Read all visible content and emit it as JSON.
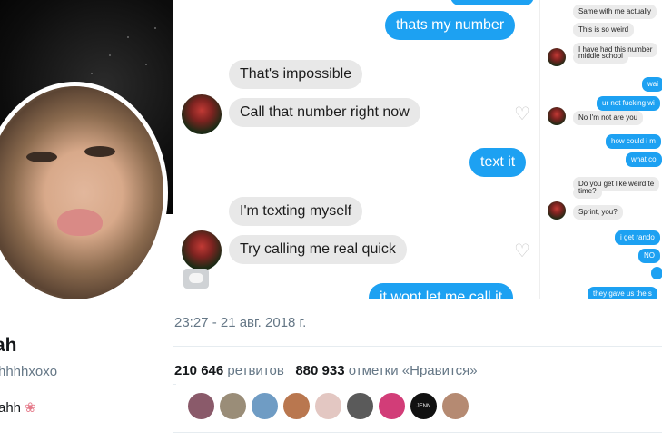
{
  "profile": {
    "name": "ah",
    "handle": "hhhhxoxo",
    "bio": "ahh",
    "bio_icon": "flower-icon"
  },
  "chat": {
    "main": [
      {
        "side": "sent",
        "text": "thats my number"
      },
      {
        "side": "recv",
        "text": "That's impossible"
      },
      {
        "side": "recv",
        "text": "Call that number right now"
      },
      {
        "side": "sent",
        "text": "text it"
      },
      {
        "side": "recv",
        "text": "I'm texting myself"
      },
      {
        "side": "recv",
        "text": "Try calling me real quick"
      },
      {
        "side": "sent",
        "text": "it wont let me call it"
      }
    ],
    "side": [
      {
        "side": "r",
        "text": "Same with me actually"
      },
      {
        "side": "r",
        "text": "This is so weird"
      },
      {
        "side": "r",
        "text": "I have had this number"
      },
      {
        "side": "r",
        "text": "middle school"
      },
      {
        "side": "s",
        "text": "wai"
      },
      {
        "side": "s",
        "text": "ur not fucking wi"
      },
      {
        "side": "r",
        "text": "No I'm not are you"
      },
      {
        "side": "s",
        "text": "how could i m"
      },
      {
        "side": "s",
        "text": "what co"
      },
      {
        "side": "r",
        "text": "Do you get like weird te"
      },
      {
        "side": "r",
        "text": "time?"
      },
      {
        "side": "r",
        "text": "Sprint, you?"
      },
      {
        "side": "s",
        "text": "i get rando"
      },
      {
        "side": "s",
        "text": "NO"
      },
      {
        "side": "s",
        "text": "they gave us the s"
      }
    ]
  },
  "tweet": {
    "timestamp": "23:27 - 21 авг. 2018 г.",
    "retweets_count": "210 646",
    "retweets_label": "ретвитов",
    "likes_count": "880 933",
    "likes_label": "отметки «Нравится»"
  },
  "likers": [
    {
      "color": "#8a5a6a"
    },
    {
      "color": "#9a8d78"
    },
    {
      "color": "#6f9cc4"
    },
    {
      "color": "#b9774f"
    },
    {
      "color": "#e3c7c2"
    },
    {
      "color": "#5a5a5a"
    },
    {
      "color": "#d23d78"
    },
    {
      "color": "#111111",
      "text": "JENN"
    },
    {
      "color": "#b58a72"
    }
  ],
  "colors": {
    "accent": "#1da1f2",
    "secondary_text": "#657786",
    "divider": "#e6ecf0"
  }
}
